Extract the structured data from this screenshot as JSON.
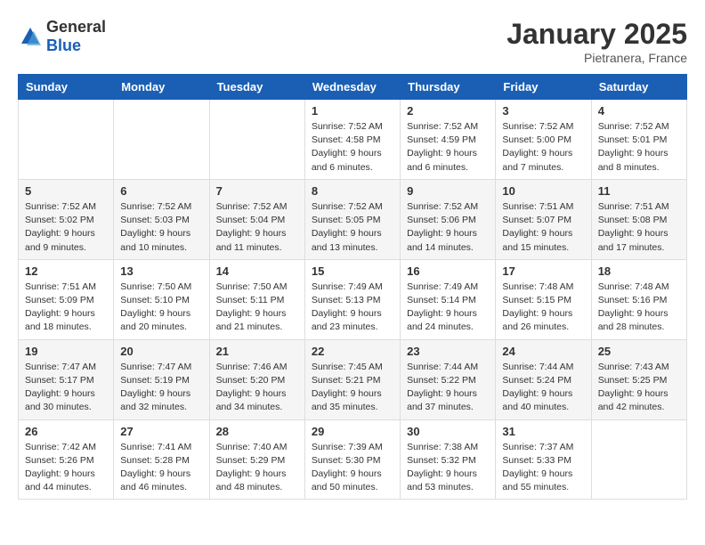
{
  "logo": {
    "text_general": "General",
    "text_blue": "Blue"
  },
  "title": "January 2025",
  "location": "Pietranera, France",
  "header": {
    "days": [
      "Sunday",
      "Monday",
      "Tuesday",
      "Wednesday",
      "Thursday",
      "Friday",
      "Saturday"
    ]
  },
  "weeks": [
    [
      {
        "day": "",
        "info": ""
      },
      {
        "day": "",
        "info": ""
      },
      {
        "day": "",
        "info": ""
      },
      {
        "day": "1",
        "info": "Sunrise: 7:52 AM\nSunset: 4:58 PM\nDaylight: 9 hours\nand 6 minutes."
      },
      {
        "day": "2",
        "info": "Sunrise: 7:52 AM\nSunset: 4:59 PM\nDaylight: 9 hours\nand 6 minutes."
      },
      {
        "day": "3",
        "info": "Sunrise: 7:52 AM\nSunset: 5:00 PM\nDaylight: 9 hours\nand 7 minutes."
      },
      {
        "day": "4",
        "info": "Sunrise: 7:52 AM\nSunset: 5:01 PM\nDaylight: 9 hours\nand 8 minutes."
      }
    ],
    [
      {
        "day": "5",
        "info": "Sunrise: 7:52 AM\nSunset: 5:02 PM\nDaylight: 9 hours\nand 9 minutes."
      },
      {
        "day": "6",
        "info": "Sunrise: 7:52 AM\nSunset: 5:03 PM\nDaylight: 9 hours\nand 10 minutes."
      },
      {
        "day": "7",
        "info": "Sunrise: 7:52 AM\nSunset: 5:04 PM\nDaylight: 9 hours\nand 11 minutes."
      },
      {
        "day": "8",
        "info": "Sunrise: 7:52 AM\nSunset: 5:05 PM\nDaylight: 9 hours\nand 13 minutes."
      },
      {
        "day": "9",
        "info": "Sunrise: 7:52 AM\nSunset: 5:06 PM\nDaylight: 9 hours\nand 14 minutes."
      },
      {
        "day": "10",
        "info": "Sunrise: 7:51 AM\nSunset: 5:07 PM\nDaylight: 9 hours\nand 15 minutes."
      },
      {
        "day": "11",
        "info": "Sunrise: 7:51 AM\nSunset: 5:08 PM\nDaylight: 9 hours\nand 17 minutes."
      }
    ],
    [
      {
        "day": "12",
        "info": "Sunrise: 7:51 AM\nSunset: 5:09 PM\nDaylight: 9 hours\nand 18 minutes."
      },
      {
        "day": "13",
        "info": "Sunrise: 7:50 AM\nSunset: 5:10 PM\nDaylight: 9 hours\nand 20 minutes."
      },
      {
        "day": "14",
        "info": "Sunrise: 7:50 AM\nSunset: 5:11 PM\nDaylight: 9 hours\nand 21 minutes."
      },
      {
        "day": "15",
        "info": "Sunrise: 7:49 AM\nSunset: 5:13 PM\nDaylight: 9 hours\nand 23 minutes."
      },
      {
        "day": "16",
        "info": "Sunrise: 7:49 AM\nSunset: 5:14 PM\nDaylight: 9 hours\nand 24 minutes."
      },
      {
        "day": "17",
        "info": "Sunrise: 7:48 AM\nSunset: 5:15 PM\nDaylight: 9 hours\nand 26 minutes."
      },
      {
        "day": "18",
        "info": "Sunrise: 7:48 AM\nSunset: 5:16 PM\nDaylight: 9 hours\nand 28 minutes."
      }
    ],
    [
      {
        "day": "19",
        "info": "Sunrise: 7:47 AM\nSunset: 5:17 PM\nDaylight: 9 hours\nand 30 minutes."
      },
      {
        "day": "20",
        "info": "Sunrise: 7:47 AM\nSunset: 5:19 PM\nDaylight: 9 hours\nand 32 minutes."
      },
      {
        "day": "21",
        "info": "Sunrise: 7:46 AM\nSunset: 5:20 PM\nDaylight: 9 hours\nand 34 minutes."
      },
      {
        "day": "22",
        "info": "Sunrise: 7:45 AM\nSunset: 5:21 PM\nDaylight: 9 hours\nand 35 minutes."
      },
      {
        "day": "23",
        "info": "Sunrise: 7:44 AM\nSunset: 5:22 PM\nDaylight: 9 hours\nand 37 minutes."
      },
      {
        "day": "24",
        "info": "Sunrise: 7:44 AM\nSunset: 5:24 PM\nDaylight: 9 hours\nand 40 minutes."
      },
      {
        "day": "25",
        "info": "Sunrise: 7:43 AM\nSunset: 5:25 PM\nDaylight: 9 hours\nand 42 minutes."
      }
    ],
    [
      {
        "day": "26",
        "info": "Sunrise: 7:42 AM\nSunset: 5:26 PM\nDaylight: 9 hours\nand 44 minutes."
      },
      {
        "day": "27",
        "info": "Sunrise: 7:41 AM\nSunset: 5:28 PM\nDaylight: 9 hours\nand 46 minutes."
      },
      {
        "day": "28",
        "info": "Sunrise: 7:40 AM\nSunset: 5:29 PM\nDaylight: 9 hours\nand 48 minutes."
      },
      {
        "day": "29",
        "info": "Sunrise: 7:39 AM\nSunset: 5:30 PM\nDaylight: 9 hours\nand 50 minutes."
      },
      {
        "day": "30",
        "info": "Sunrise: 7:38 AM\nSunset: 5:32 PM\nDaylight: 9 hours\nand 53 minutes."
      },
      {
        "day": "31",
        "info": "Sunrise: 7:37 AM\nSunset: 5:33 PM\nDaylight: 9 hours\nand 55 minutes."
      },
      {
        "day": "",
        "info": ""
      }
    ]
  ]
}
